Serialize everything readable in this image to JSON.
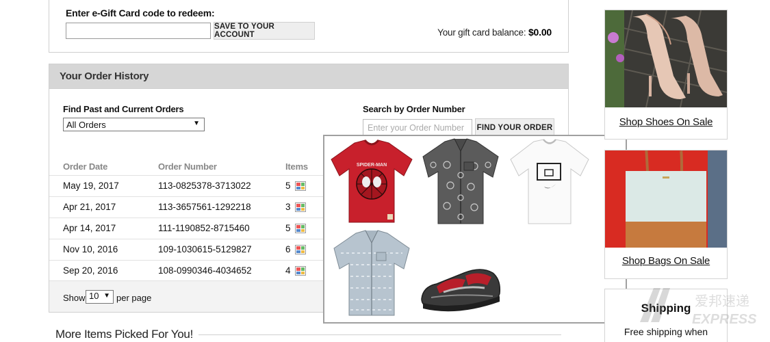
{
  "gift_card": {
    "label": "Enter e-Gift Card code to redeem:",
    "input_value": "",
    "save_button": "SAVE TO YOUR ACCOUNT",
    "balance_label": "Your gift card balance:",
    "balance_value": "$0.00"
  },
  "order_history": {
    "title": "Your Order History",
    "find_label": "Find Past and Current Orders",
    "filter_selected": "All Orders",
    "search_label": "Search by Order Number",
    "search_placeholder": "Enter your Order Number",
    "find_button": "FIND YOUR ORDER",
    "columns": [
      "Order Date",
      "Order Number",
      "Items"
    ],
    "orders": [
      {
        "date": "May 19, 2017",
        "number": "113-0825378-3713022",
        "items": "5"
      },
      {
        "date": "Apr 21, 2017",
        "number": "113-3657561-1292218",
        "items": "3"
      },
      {
        "date": "Apr 14, 2017",
        "number": "111-1190852-8715460",
        "items": "5"
      },
      {
        "date": "Nov 10, 2016",
        "number": "109-1030615-5129827",
        "items": "6"
      },
      {
        "date": "Sep 20, 2016",
        "number": "108-0990346-4034652",
        "items": "4"
      }
    ],
    "show_label": "Show",
    "per_page_value": "10",
    "per_page_label": "per page"
  },
  "more_items_title": "More Items Picked For You!",
  "popup": {
    "items": [
      {
        "icon": "red-spiderman-tshirt",
        "text": "SPIDER-MAN"
      },
      {
        "icon": "gray-print-shirt",
        "text": ""
      },
      {
        "icon": "white-basketball-tshirt",
        "text": ""
      },
      {
        "icon": "blue-button-shirt",
        "text": ""
      },
      {
        "icon": "sport-sandal",
        "text": ""
      }
    ]
  },
  "sidebar": {
    "shoes_link": "Shop Shoes On Sale",
    "bags_link": "Shop Bags On Sale",
    "shipping_title": "Shipping",
    "shipping_sub": "Free shipping when"
  },
  "watermark": {
    "text1": "爱邦速递",
    "text2": "EXPRESS"
  },
  "colors": {
    "header_bg": "#d6d6d6",
    "button_bg": "#eeeeee",
    "border": "#cfcfcf"
  }
}
